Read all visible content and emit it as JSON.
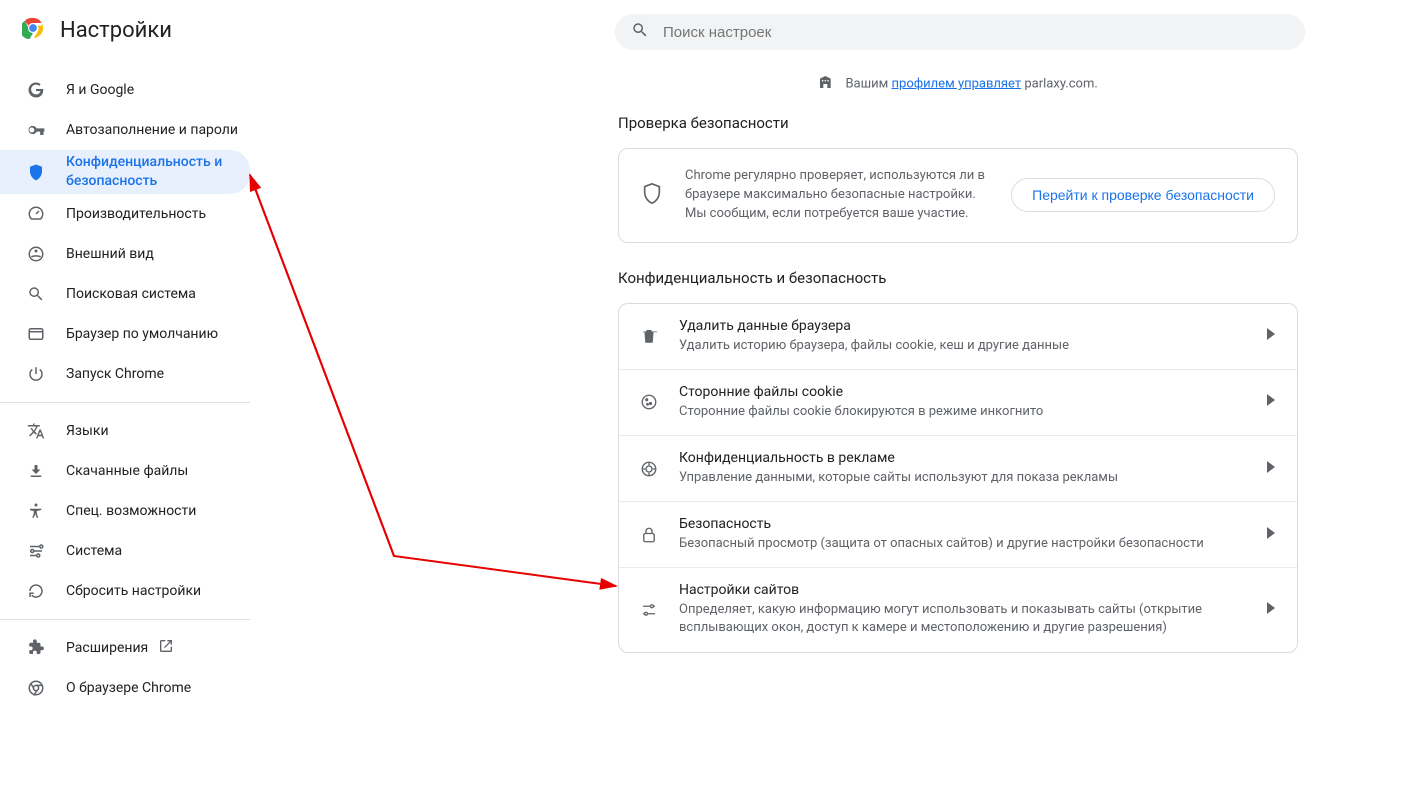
{
  "header": {
    "title": "Настройки"
  },
  "search": {
    "placeholder": "Поиск настроек"
  },
  "sidebar": {
    "items": [
      {
        "id": "you-and-google",
        "label": "Я и Google"
      },
      {
        "id": "autofill",
        "label": "Автозаполнение и пароли"
      },
      {
        "id": "privacy",
        "label": "Конфиденциальность и безопасность",
        "active": true
      },
      {
        "id": "performance",
        "label": "Производительность"
      },
      {
        "id": "appearance",
        "label": "Внешний вид"
      },
      {
        "id": "search-engine",
        "label": "Поисковая система"
      },
      {
        "id": "default-browser",
        "label": "Браузер по умолчанию"
      },
      {
        "id": "on-startup",
        "label": "Запуск Chrome"
      }
    ],
    "items2": [
      {
        "id": "languages",
        "label": "Языки"
      },
      {
        "id": "downloads",
        "label": "Скачанные файлы"
      },
      {
        "id": "accessibility",
        "label": "Спец. возможности"
      },
      {
        "id": "system",
        "label": "Система"
      },
      {
        "id": "reset",
        "label": "Сбросить настройки"
      }
    ],
    "items3": [
      {
        "id": "extensions",
        "label": "Расширения",
        "external": true
      },
      {
        "id": "about",
        "label": "О браузере Chrome"
      }
    ]
  },
  "managed": {
    "prefix": "Вашим ",
    "link": "профилем управляет",
    "suffix": " parlaxy.com."
  },
  "sections": {
    "safety_check_label": "Проверка безопасности",
    "privacy_label": "Конфиденциальность и безопасность"
  },
  "safety_check": {
    "text": "Chrome регулярно проверяет, используются ли в браузере максимально безопасные настройки. Мы сообщим, если потребуется ваше участие.",
    "button": "Перейти к проверке безопасности"
  },
  "privacy_rows": [
    {
      "id": "clear-data",
      "title": "Удалить данные браузера",
      "desc": "Удалить историю браузера, файлы cookie, кеш и другие данные"
    },
    {
      "id": "third-party-cookies",
      "title": "Сторонние файлы cookie",
      "desc": "Сторонние файлы cookie блокируются в режиме инкогнито"
    },
    {
      "id": "ad-privacy",
      "title": "Конфиденциальность в рекламе",
      "desc": "Управление данными, которые сайты используют для показа рекламы"
    },
    {
      "id": "security",
      "title": "Безопасность",
      "desc": "Безопасный просмотр (защита от опасных сайтов) и другие настройки безопасности"
    },
    {
      "id": "site-settings",
      "title": "Настройки сайтов",
      "desc": "Определяет, какую информацию могут использовать и показывать сайты (открытие всплывающих окон, доступ к камере и местоположению и другие разрешения)"
    }
  ]
}
